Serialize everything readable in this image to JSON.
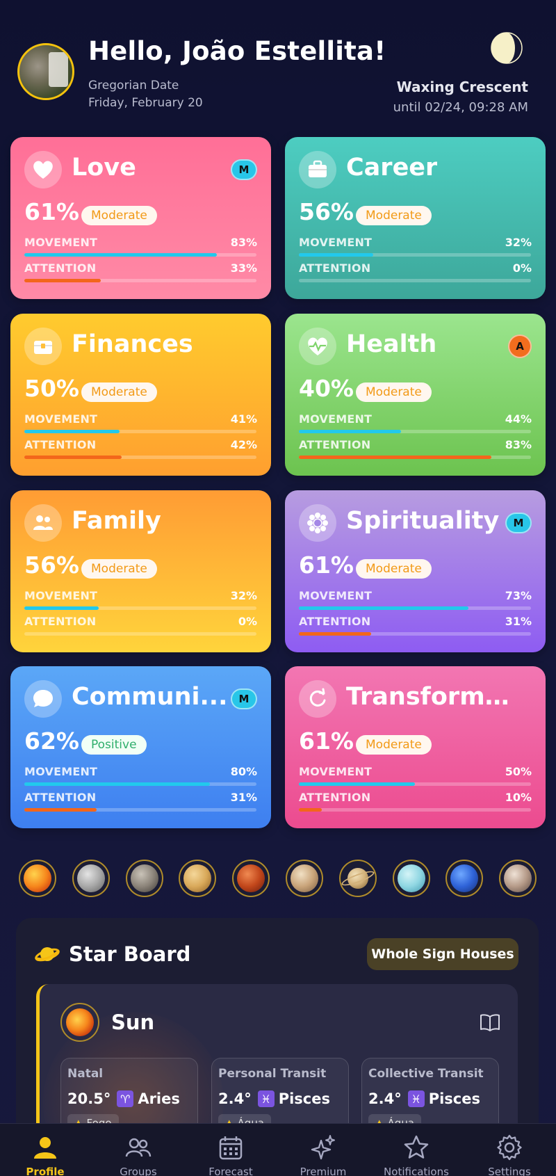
{
  "header": {
    "greeting": "Hello, João Estellita!",
    "date_label": "Gregorian Date",
    "date_value": "Friday, February 20",
    "moon_phase": "Waxing Crescent",
    "moon_until": "until 02/24, 09:28 AM"
  },
  "cards": [
    {
      "key": "love",
      "title": "Love",
      "icon": "heart-icon",
      "badge": "M",
      "badge_color": "#28c6e8",
      "percent": "61%",
      "status": "Moderate",
      "movement_label": "MOVEMENT",
      "movement_value": "83%",
      "movement": 83,
      "attention_label": "ATTENTION",
      "attention_value": "33%",
      "attention": 33
    },
    {
      "key": "career",
      "title": "Career",
      "icon": "briefcase-icon",
      "badge": "",
      "percent": "56%",
      "status": "Moderate",
      "movement_label": "MOVEMENT",
      "movement_value": "32%",
      "movement": 32,
      "attention_label": "ATTENTION",
      "attention_value": "0%",
      "attention": 0
    },
    {
      "key": "finances",
      "title": "Finances",
      "icon": "treasure-chest-icon",
      "badge": "",
      "percent": "50%",
      "status": "Moderate",
      "movement_label": "MOVEMENT",
      "movement_value": "41%",
      "movement": 41,
      "attention_label": "ATTENTION",
      "attention_value": "42%",
      "attention": 42
    },
    {
      "key": "health",
      "title": "Health",
      "icon": "heart-pulse-icon",
      "badge": "A",
      "badge_color": "#f26d1e",
      "percent": "40%",
      "status": "Moderate",
      "movement_label": "MOVEMENT",
      "movement_value": "44%",
      "movement": 44,
      "attention_label": "ATTENTION",
      "attention_value": "83%",
      "attention": 83
    },
    {
      "key": "family",
      "title": "Family",
      "icon": "people-icon",
      "badge": "",
      "percent": "56%",
      "status": "Moderate",
      "movement_label": "MOVEMENT",
      "movement_value": "32%",
      "movement": 32,
      "attention_label": "ATTENTION",
      "attention_value": "0%",
      "attention": 0
    },
    {
      "key": "spirituality",
      "title": "Spirituality",
      "icon": "lotus-icon",
      "badge": "M",
      "badge_color": "#28c6e8",
      "percent": "61%",
      "status": "Moderate",
      "movement_label": "MOVEMENT",
      "movement_value": "73%",
      "movement": 73,
      "attention_label": "ATTENTION",
      "attention_value": "31%",
      "attention": 31
    },
    {
      "key": "communication",
      "title": "Communi...",
      "icon": "chat-bubble-icon",
      "badge": "M",
      "badge_color": "#28c6e8",
      "percent": "62%",
      "status": "Positive",
      "movement_label": "MOVEMENT",
      "movement_value": "80%",
      "movement": 80,
      "attention_label": "ATTENTION",
      "attention_value": "31%",
      "attention": 31
    },
    {
      "key": "transformation",
      "title": "Transforma...",
      "icon": "refresh-icon",
      "badge": "",
      "percent": "61%",
      "status": "Moderate",
      "movement_label": "MOVEMENT",
      "movement_value": "50%",
      "movement": 50,
      "attention_label": "ATTENTION",
      "attention_value": "10%",
      "attention": 10
    }
  ],
  "planets": [
    {
      "name": "sun",
      "colors": [
        "#ffd34d",
        "#f6861c",
        "#c9350e"
      ]
    },
    {
      "name": "moon",
      "colors": [
        "#e4e4e4",
        "#a8a8a8",
        "#6e6e6e"
      ]
    },
    {
      "name": "mercury",
      "colors": [
        "#c9c3b8",
        "#8c847a",
        "#4d4842"
      ]
    },
    {
      "name": "venus",
      "colors": [
        "#f4d79a",
        "#d9a95a",
        "#9c6c2c"
      ]
    },
    {
      "name": "mars",
      "colors": [
        "#f08a52",
        "#c2471b",
        "#7a2410"
      ]
    },
    {
      "name": "jupiter",
      "colors": [
        "#f1e0c4",
        "#c9a47a",
        "#8a6a4a"
      ]
    },
    {
      "name": "saturn",
      "colors": [
        "#f3e3bd",
        "#d3b27b",
        "#8f6f3e"
      ]
    },
    {
      "name": "uranus",
      "colors": [
        "#d4f4f7",
        "#8fd6e2",
        "#4ea4b8"
      ]
    },
    {
      "name": "neptune",
      "colors": [
        "#6fa8ff",
        "#2f63d8",
        "#1b3a8c"
      ]
    },
    {
      "name": "pluto",
      "colors": [
        "#efe2d6",
        "#b59a88",
        "#6e5a50"
      ]
    }
  ],
  "star_board": {
    "title": "Star Board",
    "icon": "saturn-icon",
    "house_system_button": "Whole Sign Houses",
    "planet": {
      "name": "Sun",
      "positions": [
        {
          "label": "Natal",
          "degree": "20.5°",
          "sign_glyph": "♈",
          "sign": "Aries",
          "element": "Fogo"
        },
        {
          "label": "Personal Transit",
          "degree": "2.4°",
          "sign_glyph": "♓",
          "sign": "Pisces",
          "element": "Água"
        },
        {
          "label": "Collective Transit",
          "degree": "2.4°",
          "sign_glyph": "♓",
          "sign": "Pisces",
          "element": "Água"
        }
      ]
    }
  },
  "nav": [
    {
      "label": "Profile",
      "icon": "person-icon",
      "active": true
    },
    {
      "label": "Groups",
      "icon": "groups-icon",
      "active": false
    },
    {
      "label": "Forecast",
      "icon": "calendar-icon",
      "active": false
    },
    {
      "label": "Premium",
      "icon": "sparkles-icon",
      "active": false
    },
    {
      "label": "Notifications",
      "icon": "star-icon",
      "active": false
    },
    {
      "label": "Settings",
      "icon": "gear-icon",
      "active": false
    }
  ],
  "colors": {
    "accent": "#f5c518",
    "movement_bar": "#22c9ec",
    "attention_bar": "#f3661b",
    "background": "#131638"
  }
}
